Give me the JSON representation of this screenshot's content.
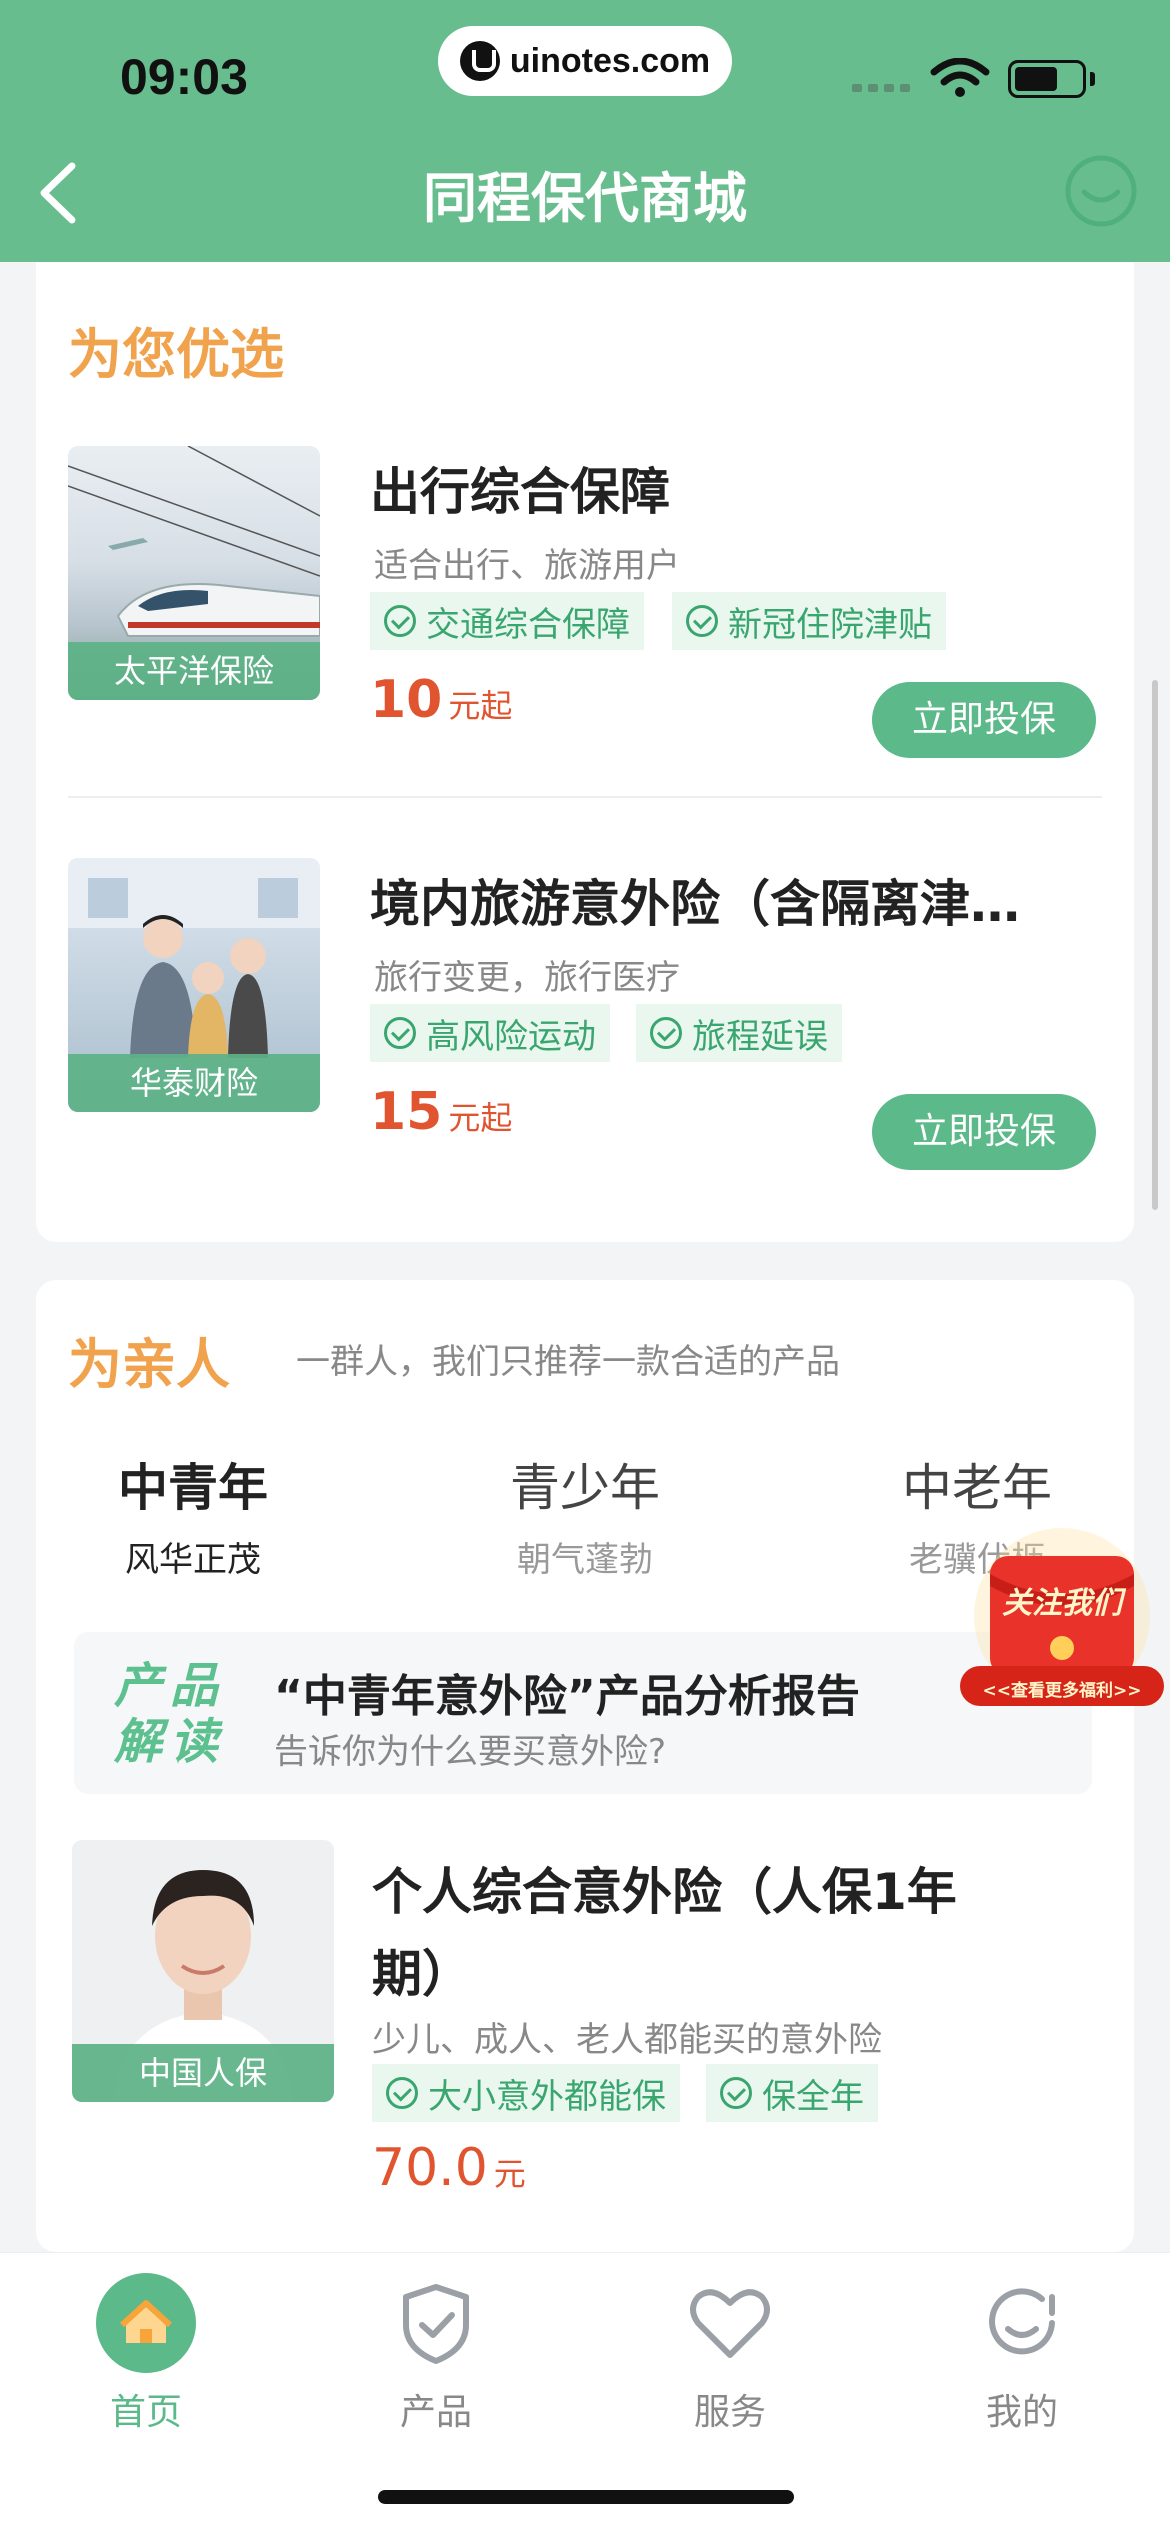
{
  "status": {
    "time": "09:03",
    "url": "uinotes.com"
  },
  "header": {
    "title": "同程保代商城"
  },
  "featured": {
    "title": "为您优选",
    "products": [
      {
        "title": "出行综合保障",
        "subtitle": "适合出行、旅游用户",
        "tags": [
          "交通综合保障",
          "新冠住院津贴"
        ],
        "price": "10",
        "price_unit": "元起",
        "insurer": "太平洋保险",
        "button": "立即投保"
      },
      {
        "title": "境内旅游意外险（含隔离津…",
        "subtitle": "旅行变更，旅行医疗",
        "tags": [
          "高风险运动",
          "旅程延误"
        ],
        "price": "15",
        "price_unit": "元起",
        "insurer": "华泰财险",
        "button": "立即投保"
      }
    ]
  },
  "family": {
    "title": "为亲人",
    "subtitle": "一群人，我们只推荐一款合适的产品",
    "tabs": [
      {
        "name": "中青年",
        "slogan": "风华正茂"
      },
      {
        "name": "青少年",
        "slogan": "朝气蓬勃"
      },
      {
        "name": "中老年",
        "slogan": "老骥伏枥"
      }
    ],
    "report": {
      "badge": "产品解读",
      "title": "“中青年意外险”产品分析报告",
      "subtitle": "告诉你为什么要买意外险?"
    },
    "product": {
      "title_line1": "个人综合意外险（人保1年",
      "title_line2": "期）",
      "subtitle": "少儿、成人、老人都能买的意外险",
      "tags": [
        "大小意外都能保",
        "保全年"
      ],
      "price": "70.0",
      "price_unit": "元",
      "insurer": "中国人保"
    }
  },
  "promo": {
    "title": "关注我们",
    "subtitle": "<<查看更多福利>>"
  },
  "nav": [
    {
      "label": "首页",
      "icon": "home-icon",
      "active": true
    },
    {
      "label": "产品",
      "icon": "shield-icon",
      "active": false
    },
    {
      "label": "服务",
      "icon": "heart-icon",
      "active": false
    },
    {
      "label": "我的",
      "icon": "user-smile-icon",
      "active": false
    }
  ],
  "colors": {
    "brand": "#68bd8e",
    "accent": "#f0a24d",
    "price": "#e05530",
    "button": "#5bb98a"
  }
}
